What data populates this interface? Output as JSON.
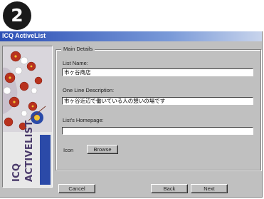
{
  "step": {
    "number": "2"
  },
  "window": {
    "title": "ICQ ActiveList"
  },
  "sidebar": {
    "words": [
      "ICQ",
      "ACTIVELIST"
    ]
  },
  "form": {
    "group_label": "Main Details",
    "list_name": {
      "label": "List Name:",
      "value": "市ヶ谷商店"
    },
    "description": {
      "label": "One Line Description:",
      "value": "市ヶ谷近辺で働いている人の憩いの場です"
    },
    "homepage": {
      "label": "List's Homepage:",
      "value": ""
    },
    "icon": {
      "label": "Icon",
      "browse_label": "Browse"
    }
  },
  "buttons": {
    "cancel": "Cancel",
    "back": "Back",
    "next": "Next"
  },
  "colors": {
    "titlebar_start": "#2c4fb6",
    "titlebar_end": "#c8d4ec",
    "dialog_bg": "#c0c0c0",
    "flower_red": "#b8321e",
    "flower_white": "#ffffff",
    "side_text": "#4a3a6a"
  }
}
